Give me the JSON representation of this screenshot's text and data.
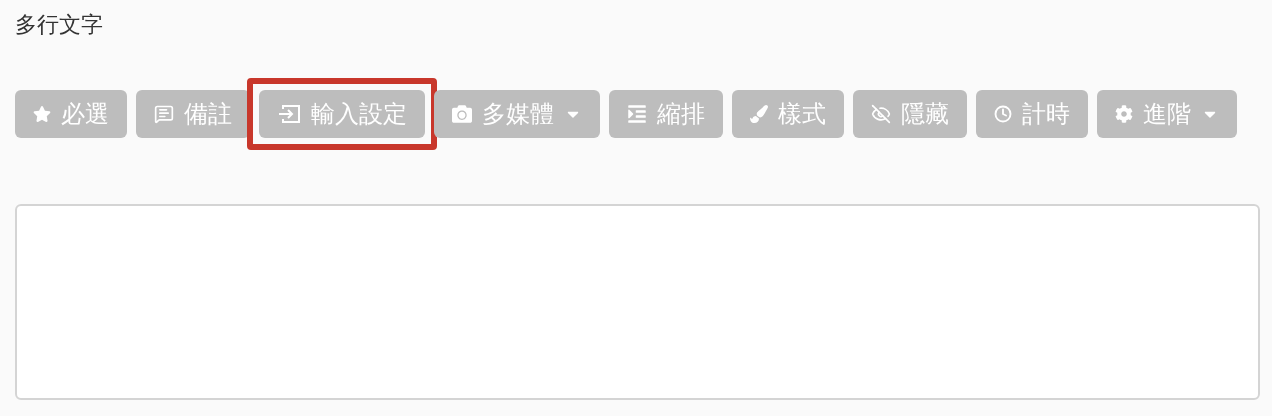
{
  "title": "多行文字",
  "toolbar": [
    {
      "kind": "star",
      "label": "必選",
      "has_menu": false,
      "highlighted": false
    },
    {
      "kind": "comment",
      "label": "備註",
      "has_menu": false,
      "highlighted": false
    },
    {
      "kind": "input",
      "label": "輸入設定",
      "has_menu": false,
      "highlighted": true
    },
    {
      "kind": "camera",
      "label": "多媒體",
      "has_menu": true,
      "highlighted": false
    },
    {
      "kind": "indent",
      "label": "縮排",
      "has_menu": false,
      "highlighted": false
    },
    {
      "kind": "brush",
      "label": "樣式",
      "has_menu": false,
      "highlighted": false
    },
    {
      "kind": "hidden",
      "label": "隱藏",
      "has_menu": false,
      "highlighted": false
    },
    {
      "kind": "clock",
      "label": "計時",
      "has_menu": false,
      "highlighted": false
    },
    {
      "kind": "gear",
      "label": "進階",
      "has_menu": true,
      "highlighted": false
    }
  ]
}
